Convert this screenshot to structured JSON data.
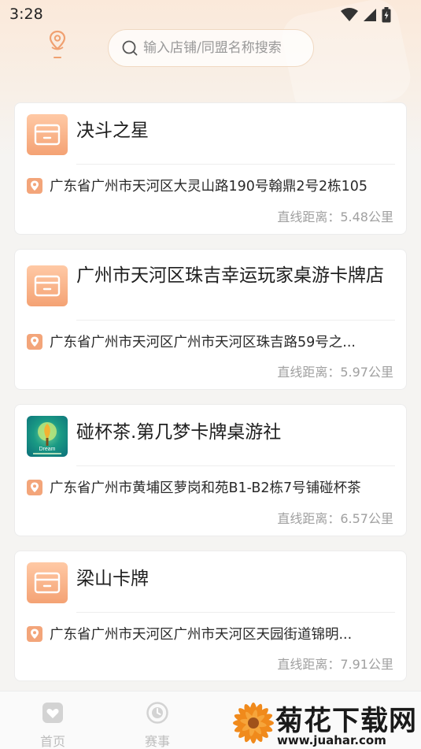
{
  "status_bar": {
    "time": "3:28"
  },
  "search": {
    "placeholder": "输入店铺/同盟名称搜索"
  },
  "stores": [
    {
      "name": "决斗之星",
      "thumb": "store-icon",
      "address": "广东省广州市天河区大灵山路190号翰鼎2号2栋105",
      "distance": "直线距离：5.48公里"
    },
    {
      "name": "广州市天河区珠吉幸运玩家桌游卡牌店",
      "thumb": "store-icon",
      "address": "广东省广州市天河区广州市天河区珠吉路59号之...",
      "distance": "直线距离：5.97公里"
    },
    {
      "name": "碰杯茶.第几梦卡牌桌游社",
      "thumb": "dream-logo",
      "thumb_text": "Dream",
      "address": "广东省广州市黄埔区萝岗和苑B1-B2栋7号铺碰杯茶",
      "distance": "直线距离：6.57公里"
    },
    {
      "name": "梁山卡牌",
      "thumb": "store-icon",
      "address": "广东省广州市天河区广州市天河区天园街道锦明...",
      "distance": "直线距离：7.91公里"
    }
  ],
  "bottom_nav": [
    {
      "label": "首页",
      "icon": "home-heart-icon"
    },
    {
      "label": "赛事",
      "icon": "event-icon"
    }
  ],
  "watermark": {
    "title": "菊花下载网",
    "url": "www.juahar.com"
  },
  "colors": {
    "accent": "#f4a274",
    "pin": "#f3a57a",
    "text_muted": "#a0a0a0"
  }
}
